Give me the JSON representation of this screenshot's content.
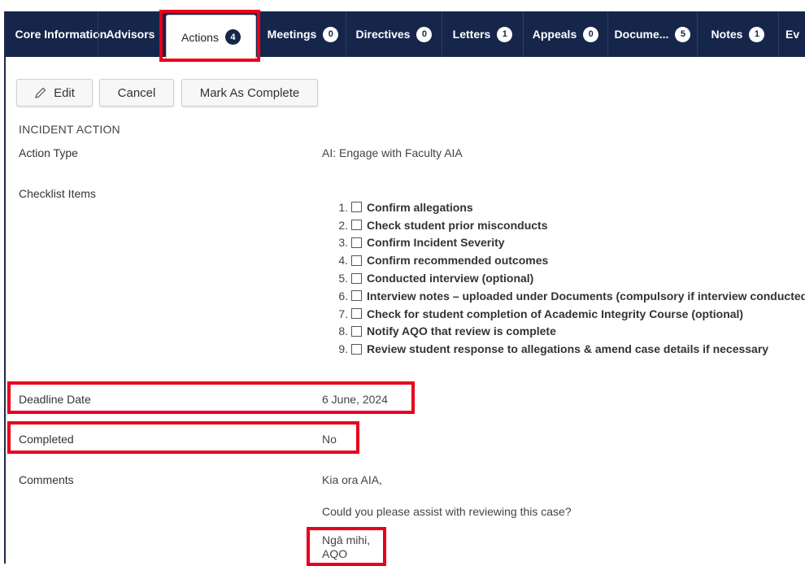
{
  "tabs": [
    {
      "label": "Core Information",
      "badge": null
    },
    {
      "label": "Advisors",
      "badge": null
    },
    {
      "label": "Actions",
      "badge": "4"
    },
    {
      "label": "Meetings",
      "badge": "0"
    },
    {
      "label": "Directives",
      "badge": "0"
    },
    {
      "label": "Letters",
      "badge": "1"
    },
    {
      "label": "Appeals",
      "badge": "0"
    },
    {
      "label": "Docume...",
      "badge": "5"
    },
    {
      "label": "Notes",
      "badge": "1"
    },
    {
      "label": "Ev",
      "badge": null
    }
  ],
  "toolbar": {
    "edit_label": "Edit",
    "edit_icon": "pencil-icon",
    "cancel_label": "Cancel",
    "complete_label": "Mark As Complete"
  },
  "section": {
    "title": "INCIDENT ACTION"
  },
  "fields": {
    "action_type": {
      "label": "Action Type",
      "value": "AI: Engage with Faculty AIA"
    },
    "checklist": {
      "label": "Checklist Items"
    },
    "deadline": {
      "label": "Deadline Date",
      "value": "6 June, 2024"
    },
    "completed": {
      "label": "Completed",
      "value": "No"
    },
    "comments": {
      "label": "Comments",
      "line1": "Kia ora AIA,",
      "line2": "Could you please assist with reviewing this case?",
      "line3": "Ngā mihi,",
      "line4": "AQO"
    }
  },
  "checklist_items": [
    {
      "num": "1.",
      "text": "Confirm allegations",
      "checked": false
    },
    {
      "num": "2.",
      "text": "Check student prior misconducts",
      "checked": false
    },
    {
      "num": "3.",
      "text": "Confirm Incident Severity",
      "checked": false
    },
    {
      "num": "4.",
      "text": "Confirm recommended outcomes",
      "checked": false
    },
    {
      "num": "5.",
      "text": "Conducted interview (optional)",
      "checked": false
    },
    {
      "num": "6.",
      "text": "Interview notes – uploaded under Documents (compulsory if interview conducted)",
      "checked": false
    },
    {
      "num": "7.",
      "text": "Check for student completion of Academic Integrity Course (optional)",
      "checked": false
    },
    {
      "num": "8.",
      "text": "Notify AQO that review is complete",
      "checked": false
    },
    {
      "num": "9.",
      "text": "Review student response to allegations & amend case details if necessary",
      "checked": false
    }
  ],
  "colors": {
    "navbar": "#16264a",
    "highlight": "#e8001c"
  }
}
